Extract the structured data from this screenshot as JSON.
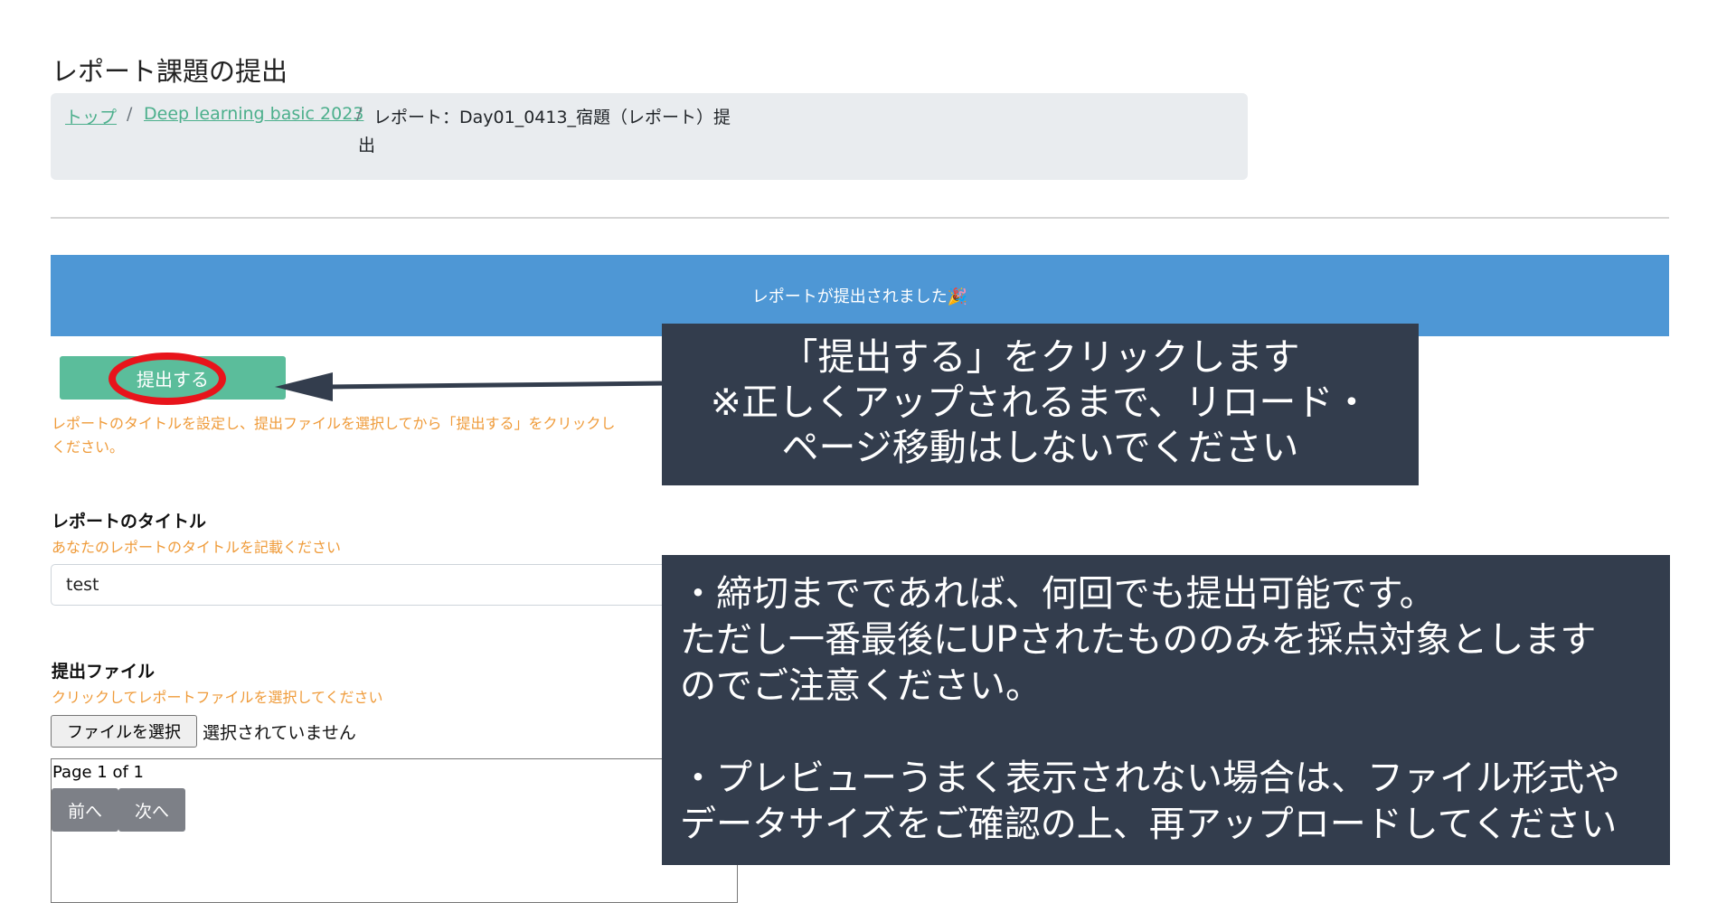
{
  "page": {
    "title": "レポート課題の提出"
  },
  "breadcrumb": {
    "home": "トップ",
    "course": "Deep learning basic 2023",
    "separator": "/",
    "current_line1": "レポート：Day01_0413_宿題（レポート）提",
    "current_line2": "出"
  },
  "alert": {
    "message": "レポートが提出されました🎉"
  },
  "submit": {
    "label": "提出する",
    "help_line1": "レポートのタイトルを設定し、提出ファイルを選択してから「提出する」をクリックし",
    "help_line2": "ください。"
  },
  "title_field": {
    "label": "レポートのタイトル",
    "hint": "あなたのレポートのタイトルを記載ください",
    "value": "test"
  },
  "file_field": {
    "label": "提出ファイル",
    "hint": "クリックしてレポートファイルを選択してください",
    "button": "ファイルを選択",
    "status": "選択されていません"
  },
  "preview": {
    "page_info": "Page 1 of 1",
    "prev": "前へ",
    "next": "次へ"
  },
  "annotations": {
    "note1": {
      "line1": "「提出する」をクリックします",
      "line2": "※正しくアップされるまで、リロード・",
      "line3": "ページ移動はしないでください"
    },
    "note2": {
      "line1": "・締切までであれば、何回でも提出可能です。",
      "line2": "ただし一番最後にUPされたもののみを採点対象とします",
      "line3": "のでご注意ください。",
      "line4": "・プレビューうまく表示されない場合は、ファイル形式や",
      "line5": "データサイズをご確認の上、再アップロードしてください"
    }
  },
  "colors": {
    "alert_bg": "#4e97d5",
    "submit_bg": "#5bbd9b",
    "highlight_ring": "#e8141b",
    "hint_text": "#ef9b3a",
    "note_bg": "#333d4d",
    "link": "#4caf8c"
  },
  "icons": {
    "arrow": "left-arrow-icon",
    "ring": "highlight-ring"
  }
}
